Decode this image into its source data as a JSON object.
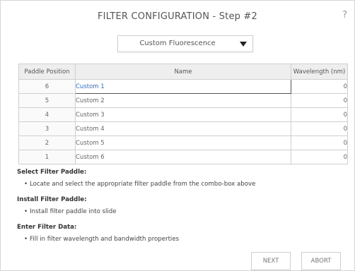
{
  "dialog": {
    "title": "FILTER CONFIGURATION - Step #2",
    "help_label": "?"
  },
  "filter_select": {
    "selected": "Custom Fluorescence"
  },
  "table": {
    "headers": [
      "Paddle Position",
      "Name",
      "Wavelength (nm)"
    ],
    "rows": [
      {
        "position": "6",
        "name": "Custom 1",
        "wavelength": "0"
      },
      {
        "position": "5",
        "name": "Custom 2",
        "wavelength": "0"
      },
      {
        "position": "4",
        "name": "Custom 3",
        "wavelength": "0"
      },
      {
        "position": "3",
        "name": "Custom 4",
        "wavelength": "0"
      },
      {
        "position": "2",
        "name": "Custom 5",
        "wavelength": "0"
      },
      {
        "position": "1",
        "name": "Custom 6",
        "wavelength": "0"
      }
    ]
  },
  "instructions": [
    {
      "title": "Select Filter Paddle:",
      "bullet": "Locate and select the appropriate filter paddle from the combo-box above"
    },
    {
      "title": "Install Filter Paddle:",
      "bullet": "Install filter paddle into slide"
    },
    {
      "title": "Enter Filter Data:",
      "bullet": "Fill in filter wavelength and bandwidth properties"
    }
  ],
  "buttons": {
    "next": "NEXT",
    "abort": "ABORT"
  }
}
